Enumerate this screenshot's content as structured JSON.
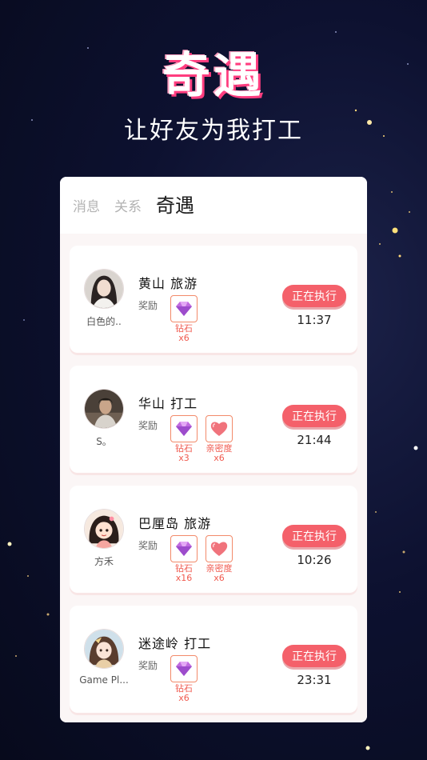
{
  "hero": {
    "title": "奇遇",
    "subtitle": "让好友为我打工"
  },
  "tabs": [
    {
      "label": "消息",
      "active": false
    },
    {
      "label": "关系",
      "active": false
    },
    {
      "label": "奇遇",
      "active": true
    }
  ],
  "colors": {
    "accent": "#f4606a",
    "reward_text": "#f05a4f",
    "reward_border": "#f28a6a",
    "diamond": "#c06be0",
    "heart": "#f0737c"
  },
  "cards": [
    {
      "nickname": "白色的..",
      "avatar_icon": "girl-portrait-avatar",
      "title": "黄山  旅游",
      "reward_label": "奖励",
      "rewards": [
        {
          "icon": "diamond-icon",
          "name": "钻石",
          "count": "x6"
        }
      ],
      "status": "正在执行",
      "time": "11:37"
    },
    {
      "nickname": "S。",
      "avatar_icon": "photo-portrait-avatar",
      "title": "华山  打工",
      "reward_label": "奖励",
      "rewards": [
        {
          "icon": "diamond-icon",
          "name": "钻石",
          "count": "x3"
        },
        {
          "icon": "heart-icon",
          "name": "亲密度",
          "count": "x6"
        }
      ],
      "status": "正在执行",
      "time": "21:44"
    },
    {
      "nickname": "方禾",
      "avatar_icon": "cartoon-girl-avatar",
      "title": "巴厘岛  旅游",
      "reward_label": "奖励",
      "rewards": [
        {
          "icon": "diamond-icon",
          "name": "钻石",
          "count": "x16"
        },
        {
          "icon": "heart-icon",
          "name": "亲密度",
          "count": "x6"
        }
      ],
      "status": "正在执行",
      "time": "10:26"
    },
    {
      "nickname": "Game Pl...",
      "avatar_icon": "anime-avatar",
      "title": "迷途岭  打工",
      "reward_label": "奖励",
      "rewards": [
        {
          "icon": "diamond-icon",
          "name": "钻石",
          "count": "x6"
        }
      ],
      "status": "正在执行",
      "time": "23:31"
    }
  ]
}
